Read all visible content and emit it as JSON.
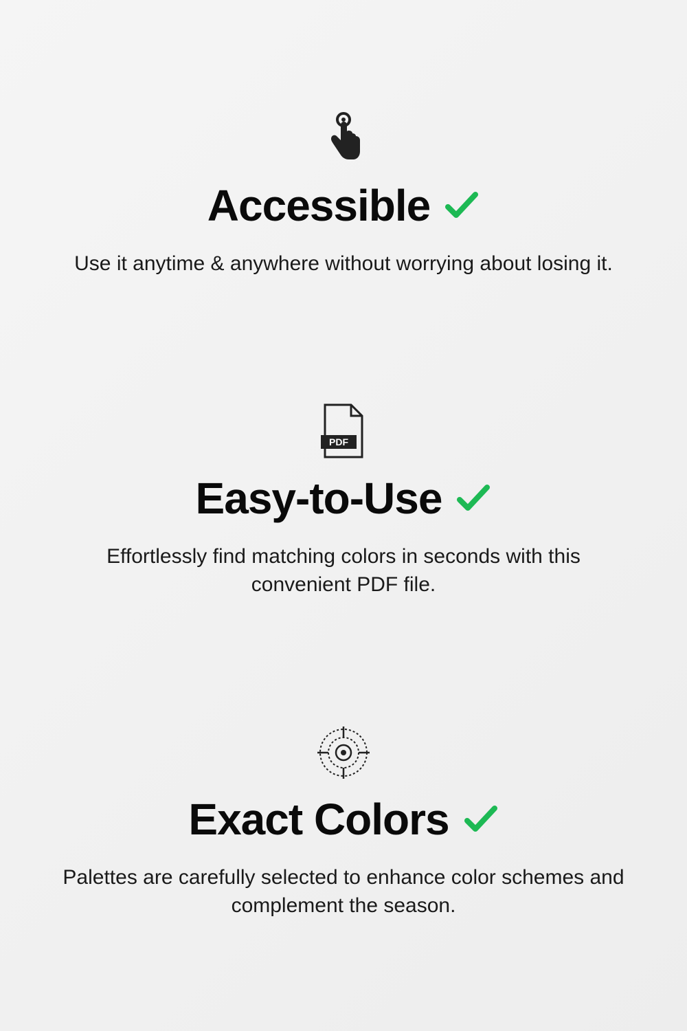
{
  "colors": {
    "text": "#0a0a0a",
    "description": "#1a1a1a",
    "check": "#1DB954",
    "icon": "#222222"
  },
  "features": [
    {
      "title": "Accessible",
      "description": "Use it anytime & anywhere without worrying about losing it."
    },
    {
      "title": "Easy-to-Use",
      "description": "Effortlessly find matching colors in seconds with this convenient PDF file."
    },
    {
      "title": "Exact Colors",
      "description": "Palettes are carefully selected to enhance color schemes and complement the season."
    }
  ]
}
